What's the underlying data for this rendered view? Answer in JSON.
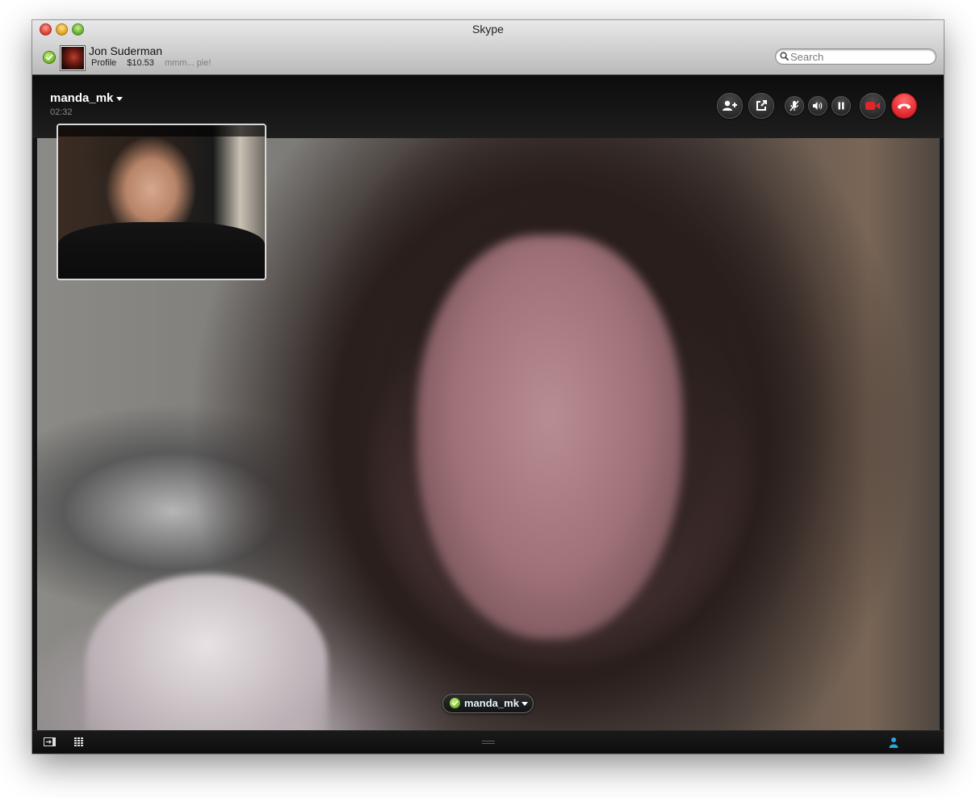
{
  "window": {
    "title": "Skype"
  },
  "account": {
    "name": "Jon Suderman",
    "profile_label": "Profile",
    "balance": "$10.53",
    "mood": "mmm... pie!",
    "status": "online"
  },
  "search": {
    "placeholder": "Search",
    "value": ""
  },
  "call": {
    "contact": "manda_mk",
    "duration": "02:32",
    "controls": [
      "add-participant-icon",
      "share-screen-icon",
      "mute-microphone-icon",
      "volume-icon",
      "pause-icon",
      "video-camera-icon",
      "hang-up-icon"
    ],
    "participant_label": "manda_mk"
  },
  "colors": {
    "online_green": "#6fb327",
    "hangup_red": "#e0262c",
    "video_red": "#e0262c",
    "contacts_blue": "#29a4e0"
  }
}
